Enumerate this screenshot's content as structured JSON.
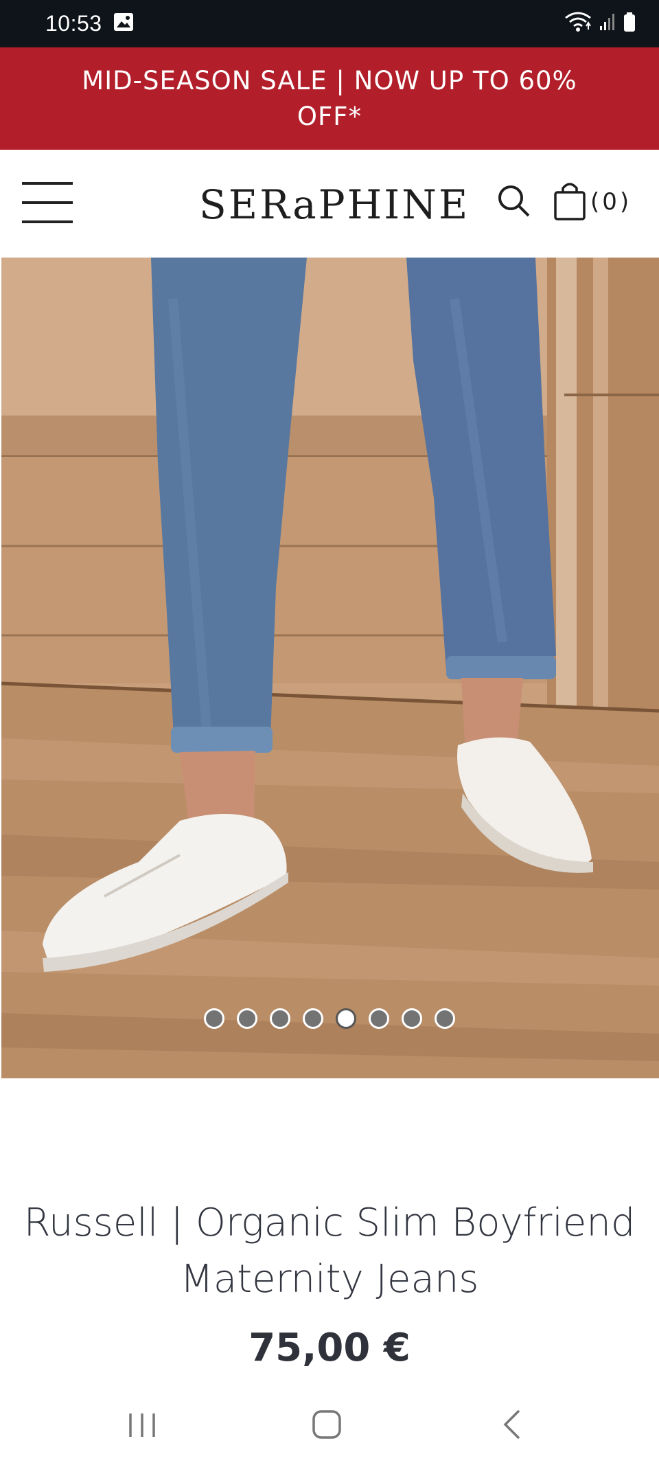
{
  "status_bar": {
    "time": "10:53",
    "icons": [
      "image-icon",
      "wifi-icon",
      "signal-icon",
      "battery-icon"
    ]
  },
  "promo": {
    "text": "MID-SEASON SALE | NOW UP TO 60% OFF*"
  },
  "header": {
    "logo": "SERaPHINE",
    "cart_count": "(0)",
    "icons": [
      "hamburger-menu-icon",
      "search-icon",
      "shopping-bag-icon"
    ]
  },
  "gallery": {
    "total_images": 8,
    "active_index": 4
  },
  "product": {
    "name": "Russell | Organic Slim Boyfriend Maternity Jeans",
    "price": "75,00 €"
  },
  "colors": {
    "promo_background": "#b21f2a",
    "status_bar": "#0f141a",
    "text": "#333640"
  },
  "navbar": {
    "icons": [
      "recent-apps-icon",
      "home-icon",
      "back-icon"
    ]
  }
}
